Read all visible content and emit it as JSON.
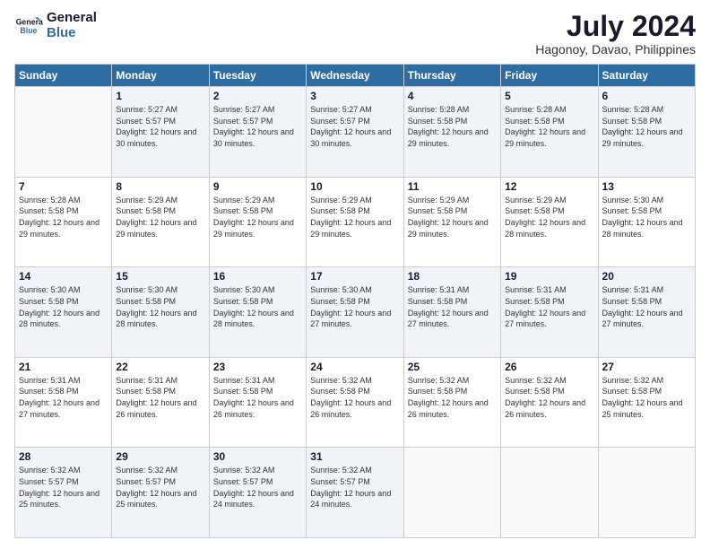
{
  "logo": {
    "text_line1": "General",
    "text_line2": "Blue"
  },
  "header": {
    "month_year": "July 2024",
    "location": "Hagonoy, Davao, Philippines"
  },
  "weekdays": [
    "Sunday",
    "Monday",
    "Tuesday",
    "Wednesday",
    "Thursday",
    "Friday",
    "Saturday"
  ],
  "weeks": [
    [
      {
        "day": "",
        "sunrise": "",
        "sunset": "",
        "daylight": ""
      },
      {
        "day": "1",
        "sunrise": "Sunrise: 5:27 AM",
        "sunset": "Sunset: 5:57 PM",
        "daylight": "Daylight: 12 hours and 30 minutes."
      },
      {
        "day": "2",
        "sunrise": "Sunrise: 5:27 AM",
        "sunset": "Sunset: 5:57 PM",
        "daylight": "Daylight: 12 hours and 30 minutes."
      },
      {
        "day": "3",
        "sunrise": "Sunrise: 5:27 AM",
        "sunset": "Sunset: 5:57 PM",
        "daylight": "Daylight: 12 hours and 30 minutes."
      },
      {
        "day": "4",
        "sunrise": "Sunrise: 5:28 AM",
        "sunset": "Sunset: 5:58 PM",
        "daylight": "Daylight: 12 hours and 29 minutes."
      },
      {
        "day": "5",
        "sunrise": "Sunrise: 5:28 AM",
        "sunset": "Sunset: 5:58 PM",
        "daylight": "Daylight: 12 hours and 29 minutes."
      },
      {
        "day": "6",
        "sunrise": "Sunrise: 5:28 AM",
        "sunset": "Sunset: 5:58 PM",
        "daylight": "Daylight: 12 hours and 29 minutes."
      }
    ],
    [
      {
        "day": "7",
        "sunrise": "Sunrise: 5:28 AM",
        "sunset": "Sunset: 5:58 PM",
        "daylight": "Daylight: 12 hours and 29 minutes."
      },
      {
        "day": "8",
        "sunrise": "Sunrise: 5:29 AM",
        "sunset": "Sunset: 5:58 PM",
        "daylight": "Daylight: 12 hours and 29 minutes."
      },
      {
        "day": "9",
        "sunrise": "Sunrise: 5:29 AM",
        "sunset": "Sunset: 5:58 PM",
        "daylight": "Daylight: 12 hours and 29 minutes."
      },
      {
        "day": "10",
        "sunrise": "Sunrise: 5:29 AM",
        "sunset": "Sunset: 5:58 PM",
        "daylight": "Daylight: 12 hours and 29 minutes."
      },
      {
        "day": "11",
        "sunrise": "Sunrise: 5:29 AM",
        "sunset": "Sunset: 5:58 PM",
        "daylight": "Daylight: 12 hours and 29 minutes."
      },
      {
        "day": "12",
        "sunrise": "Sunrise: 5:29 AM",
        "sunset": "Sunset: 5:58 PM",
        "daylight": "Daylight: 12 hours and 28 minutes."
      },
      {
        "day": "13",
        "sunrise": "Sunrise: 5:30 AM",
        "sunset": "Sunset: 5:58 PM",
        "daylight": "Daylight: 12 hours and 28 minutes."
      }
    ],
    [
      {
        "day": "14",
        "sunrise": "Sunrise: 5:30 AM",
        "sunset": "Sunset: 5:58 PM",
        "daylight": "Daylight: 12 hours and 28 minutes."
      },
      {
        "day": "15",
        "sunrise": "Sunrise: 5:30 AM",
        "sunset": "Sunset: 5:58 PM",
        "daylight": "Daylight: 12 hours and 28 minutes."
      },
      {
        "day": "16",
        "sunrise": "Sunrise: 5:30 AM",
        "sunset": "Sunset: 5:58 PM",
        "daylight": "Daylight: 12 hours and 28 minutes."
      },
      {
        "day": "17",
        "sunrise": "Sunrise: 5:30 AM",
        "sunset": "Sunset: 5:58 PM",
        "daylight": "Daylight: 12 hours and 27 minutes."
      },
      {
        "day": "18",
        "sunrise": "Sunrise: 5:31 AM",
        "sunset": "Sunset: 5:58 PM",
        "daylight": "Daylight: 12 hours and 27 minutes."
      },
      {
        "day": "19",
        "sunrise": "Sunrise: 5:31 AM",
        "sunset": "Sunset: 5:58 PM",
        "daylight": "Daylight: 12 hours and 27 minutes."
      },
      {
        "day": "20",
        "sunrise": "Sunrise: 5:31 AM",
        "sunset": "Sunset: 5:58 PM",
        "daylight": "Daylight: 12 hours and 27 minutes."
      }
    ],
    [
      {
        "day": "21",
        "sunrise": "Sunrise: 5:31 AM",
        "sunset": "Sunset: 5:58 PM",
        "daylight": "Daylight: 12 hours and 27 minutes."
      },
      {
        "day": "22",
        "sunrise": "Sunrise: 5:31 AM",
        "sunset": "Sunset: 5:58 PM",
        "daylight": "Daylight: 12 hours and 26 minutes."
      },
      {
        "day": "23",
        "sunrise": "Sunrise: 5:31 AM",
        "sunset": "Sunset: 5:58 PM",
        "daylight": "Daylight: 12 hours and 26 minutes."
      },
      {
        "day": "24",
        "sunrise": "Sunrise: 5:32 AM",
        "sunset": "Sunset: 5:58 PM",
        "daylight": "Daylight: 12 hours and 26 minutes."
      },
      {
        "day": "25",
        "sunrise": "Sunrise: 5:32 AM",
        "sunset": "Sunset: 5:58 PM",
        "daylight": "Daylight: 12 hours and 26 minutes."
      },
      {
        "day": "26",
        "sunrise": "Sunrise: 5:32 AM",
        "sunset": "Sunset: 5:58 PM",
        "daylight": "Daylight: 12 hours and 26 minutes."
      },
      {
        "day": "27",
        "sunrise": "Sunrise: 5:32 AM",
        "sunset": "Sunset: 5:58 PM",
        "daylight": "Daylight: 12 hours and 25 minutes."
      }
    ],
    [
      {
        "day": "28",
        "sunrise": "Sunrise: 5:32 AM",
        "sunset": "Sunset: 5:57 PM",
        "daylight": "Daylight: 12 hours and 25 minutes."
      },
      {
        "day": "29",
        "sunrise": "Sunrise: 5:32 AM",
        "sunset": "Sunset: 5:57 PM",
        "daylight": "Daylight: 12 hours and 25 minutes."
      },
      {
        "day": "30",
        "sunrise": "Sunrise: 5:32 AM",
        "sunset": "Sunset: 5:57 PM",
        "daylight": "Daylight: 12 hours and 24 minutes."
      },
      {
        "day": "31",
        "sunrise": "Sunrise: 5:32 AM",
        "sunset": "Sunset: 5:57 PM",
        "daylight": "Daylight: 12 hours and 24 minutes."
      },
      {
        "day": "",
        "sunrise": "",
        "sunset": "",
        "daylight": ""
      },
      {
        "day": "",
        "sunrise": "",
        "sunset": "",
        "daylight": ""
      },
      {
        "day": "",
        "sunrise": "",
        "sunset": "",
        "daylight": ""
      }
    ]
  ]
}
